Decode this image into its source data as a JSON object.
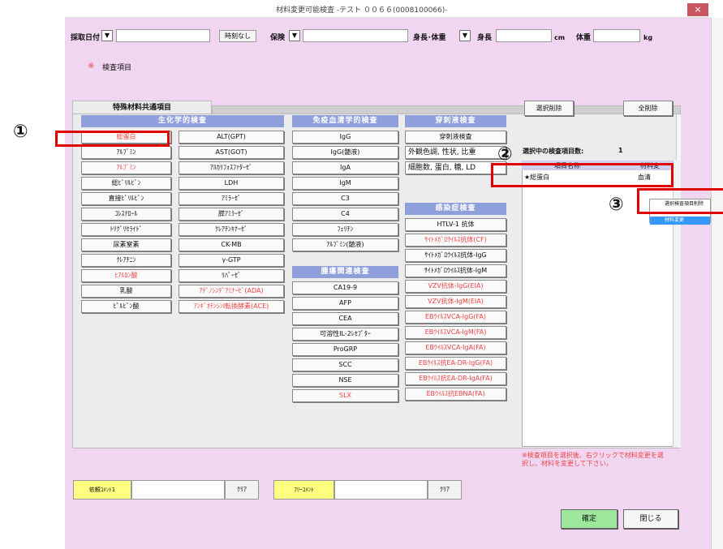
{
  "window": {
    "title": "材料変更可能検査 -テスト ００６６(0008100066)-",
    "close": "×"
  },
  "header": {
    "date_label": "採取日付",
    "none_button": "時刻なし",
    "insurance_label": "保険",
    "height_weight_label": "身長･体重",
    "height_label": "身長",
    "height_unit": "cm",
    "weight_label": "体重",
    "weight_unit": "kg"
  },
  "section": {
    "mark": "※",
    "title": "検査項目"
  },
  "tabs": {
    "active": "特殊材料共通項目"
  },
  "columns": {
    "biochem": {
      "title": "生化学的検査",
      "items": [
        {
          "label": "総蛋白",
          "red": true
        },
        {
          "label": "ｱﾙﾌﾞﾐﾝ",
          "red": false
        },
        {
          "label": "ｱﾙﾌﾞﾐﾝ",
          "red": true
        },
        {
          "label": "総ﾋﾞﾘﾙﾋﾞﾝ",
          "red": false
        },
        {
          "label": "直接ﾋﾞﾘﾙﾋﾞﾝ",
          "red": false
        },
        {
          "label": "ｺﾚｽﾃﾛｰﾙ",
          "red": false
        },
        {
          "label": "ﾄﾘｸﾞﾘｾﾗｲﾄﾞ",
          "red": false
        },
        {
          "label": "尿素窒素",
          "red": false
        },
        {
          "label": "ｸﾚｱﾁﾆﾝ",
          "red": false
        },
        {
          "label": "ﾋｱﾙﾛﾝ酸",
          "red": true
        },
        {
          "label": "乳酸",
          "red": false
        },
        {
          "label": "ﾋﾟﾙﾋﾞﾝ酸",
          "red": false
        }
      ]
    },
    "biochem2": {
      "items": [
        {
          "label": "ALT(GPT)",
          "red": false
        },
        {
          "label": "AST(GOT)",
          "red": false
        },
        {
          "label": "ｱﾙｶﾘﾌｫｽﾌｧﾀｰｾﾞ",
          "red": false
        },
        {
          "label": "LDH",
          "red": false
        },
        {
          "label": "ｱﾐﾗｰｾﾞ",
          "red": false
        },
        {
          "label": "膵ｱﾐﾗｰｾﾞ",
          "red": false
        },
        {
          "label": "ｸﾚｱﾁﾝｷﾅｰｾﾞ",
          "red": false
        },
        {
          "label": "CK-MB",
          "red": false
        },
        {
          "label": "γ-GTP",
          "red": false
        },
        {
          "label": "ﾘﾊﾟｰｾﾞ",
          "red": false
        },
        {
          "label": "ｱﾃﾞﾉｼﾝﾃﾞｱﾐﾅｰｾﾞ(ADA)",
          "red": true
        },
        {
          "label": "ｱﾝｷﾞｵﾃﾝｼﾝI転換酵素(ACE)",
          "red": true
        }
      ]
    },
    "immuno": {
      "title": "免疫血清学的検査",
      "items": [
        {
          "label": "IgG",
          "red": false
        },
        {
          "label": "IgG(髄液)",
          "red": false
        },
        {
          "label": "IgA",
          "red": false
        },
        {
          "label": "IgM",
          "red": false
        },
        {
          "label": "C3",
          "red": false
        },
        {
          "label": "C4",
          "red": false
        },
        {
          "label": "ﾌｪﾘﾁﾝ",
          "red": false
        },
        {
          "label": "ｱﾙﾌﾞﾐﾝ(髄液)",
          "red": false
        }
      ]
    },
    "tumor": {
      "title": "腫瘍関連検査",
      "items": [
        {
          "label": "CA19-9",
          "red": false
        },
        {
          "label": "AFP",
          "red": false
        },
        {
          "label": "CEA",
          "red": false
        },
        {
          "label": "可溶性IL-2ﾚｾﾌﾟﾀｰ",
          "red": false
        },
        {
          "label": "ProGRP",
          "red": false
        },
        {
          "label": "SCC",
          "red": false
        },
        {
          "label": "NSE",
          "red": false
        },
        {
          "label": "SLX",
          "red": true
        }
      ]
    },
    "puncture": {
      "title": "穿刺液検査",
      "items": [
        {
          "label": "穿刺液検査",
          "red": false
        },
        {
          "label": "外観色調, 性状, 比重",
          "red": false
        },
        {
          "label": "細胞数, 蛋白, 糖, LD",
          "red": false
        }
      ]
    },
    "infection": {
      "title": "感染症検査",
      "items": [
        {
          "label": "HTLV-1 抗体",
          "red": false
        },
        {
          "label": "ｻｲﾄﾒｶﾞﾛｳｲﾙｽ抗体(CF)",
          "red": true
        },
        {
          "label": "ｻｲﾄﾒｶﾞﾛｳｲﾙｽ抗体-IgG",
          "red": false
        },
        {
          "label": "ｻｲﾄﾒｶﾞﾛｳｲﾙｽ抗体-IgM",
          "red": false
        },
        {
          "label": "VZV抗体-IgG(EIA)",
          "red": true
        },
        {
          "label": "VZV抗体-IgM(EIA)",
          "red": true
        },
        {
          "label": "EBｳｲﾙｽVCA-IgG(FA)",
          "red": true
        },
        {
          "label": "EBｳｲﾙｽVCA-IgM(FA)",
          "red": true
        },
        {
          "label": "EBｳｲﾙｽVCA-IgA(FA)",
          "red": true
        },
        {
          "label": "EBｳｲﾙｽ抗EA-DR-IgG(FA)",
          "red": true
        },
        {
          "label": "EBｳｲﾙｽ抗EA-DR-IgA(FA)",
          "red": true
        },
        {
          "label": "EBｳｲﾙｽ抗EBNA(FA)",
          "red": true
        }
      ]
    }
  },
  "right": {
    "deselect": "選択削除",
    "delete_all": "全削除",
    "count_label": "選択中の検査項目数:",
    "count": "1",
    "col_name": "項目名称",
    "col_material": "材料変",
    "selected_item": "★総蛋白",
    "selected_mat": "血清",
    "hint": "※検査項目を選択後、右クリックで材料変更を選択し、材料を変更して下さい。"
  },
  "context_menu": {
    "items": [
      "選択検査項目削除",
      "",
      "材料変更"
    ]
  },
  "footer": {
    "comment1_label": "依頼ｺﾒﾝﾄ1",
    "clear1": "ｸﾘｱ",
    "free_label": "ﾌﾘｰｺﾒﾝﾄ",
    "clear2": "ｸﾘｱ",
    "confirm": "確定",
    "close": "閉じる"
  },
  "annotations": {
    "c1": "①",
    "c2": "②",
    "c3": "③"
  },
  "colors": {
    "bg": "#f1d6f2",
    "header": "#8f9fdc",
    "red_text": "#e44",
    "annotation": "#e00000",
    "confirm": "#9ee89e",
    "yellow": "#ffff80"
  }
}
